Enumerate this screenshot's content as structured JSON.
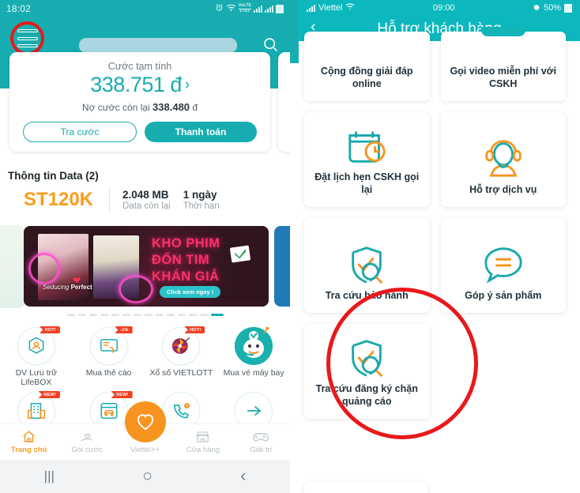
{
  "left_phone": {
    "status_bar": {
      "time": "18:02",
      "icons": [
        "alarm-icon",
        "wifi-icon",
        "volte-icon",
        "signal-icon",
        "signal-icon",
        "battery-icon"
      ],
      "volte_label": "VoLTE"
    },
    "nav": {
      "menu_icon": "hamburger-menu-icon",
      "menu_highlighted": true,
      "highlight_color": "#e8191b",
      "redacted_title": "",
      "search_icon": "search-icon"
    },
    "bill_card": {
      "subtitle": "Cước tạm tính",
      "amount": "338.751 đ",
      "chevron": "›",
      "debt_label": "Nợ cước còn lại",
      "debt_value": "338.480",
      "debt_unit": "đ",
      "button_secondary": "Tra cước",
      "button_primary": "Thanh toán"
    },
    "data_section": {
      "heading": "Thông tin Data (2)",
      "package": "ST120K",
      "items": [
        {
          "value": "2.048 MB",
          "label": "Data còn lại"
        },
        {
          "value": "1 ngày",
          "label": "Thời hạn"
        }
      ]
    },
    "banner": {
      "line1": "KHO PHIM",
      "line2": "ĐỐN TIM",
      "line3": "KHÁN GIẢ",
      "cta": "Click xem ngay !",
      "poster_caption_italic": "Seducing ",
      "poster_caption_bold": "Perfect",
      "logo": "viettel-check-logo",
      "dots_total": 14,
      "active_dot_index": 13
    },
    "services_row1": [
      {
        "label": "DV Lưu trữ LifeBOX",
        "badge": "HOT!",
        "icon": "cloud-storage-icon"
      },
      {
        "label": "Mua thẻ cào",
        "badge": "-2%",
        "icon": "scratch-card-icon"
      },
      {
        "label": "Xổ số VIETLOTT",
        "badge": "HOT!",
        "icon": "lottery-wheel-icon"
      },
      {
        "label": "Mua vé máy bay",
        "badge": "",
        "icon": "mascot-icon"
      }
    ],
    "services_row2": [
      {
        "label": "",
        "badge": "NEW!",
        "icon": "building-icon"
      },
      {
        "label": "",
        "badge": "NEW!",
        "icon": "car-booking-icon"
      },
      {
        "label": "",
        "badge": "",
        "icon": "phone-alert-icon"
      },
      {
        "label": "",
        "badge": "",
        "icon": "arrow-right-icon"
      }
    ],
    "tab_bar": {
      "items": [
        {
          "label": "Trang chủ",
          "icon": "home-icon",
          "active": true
        },
        {
          "label": "Gói cước",
          "icon": "hand-heart-icon",
          "active": false
        },
        {
          "label": "Viettel++",
          "icon": "heart-icon",
          "active": false
        },
        {
          "label": "Cửa hàng",
          "icon": "store-icon",
          "active": false
        },
        {
          "label": "Giải trí",
          "icon": "gamepad-icon",
          "active": false
        }
      ],
      "fab_icon": "heart-icon",
      "fab_color": "#f79420"
    },
    "system_nav": {
      "recents": "|||",
      "home": "○",
      "back": "‹"
    }
  },
  "right_phone": {
    "status_bar": {
      "carrier": "Viettel",
      "signal_icon": "signal-icon",
      "wifi_icon": "wifi-icon",
      "time": "09:00",
      "alarm_icon": "alarm-icon",
      "battery_text": "50%",
      "battery_icon": "battery-icon"
    },
    "header": {
      "back_icon": "chevron-left-icon",
      "title": "Hỗ trợ khách hàng"
    },
    "cards": [
      {
        "label": "Cộng đồng giải đáp online",
        "icon": "community-icon",
        "partial": true
      },
      {
        "label": "Gọi video miễn phí với CSKH",
        "icon": "video-call-icon",
        "partial": true
      },
      {
        "label": "Đặt lịch hẹn CSKH gọi lại",
        "icon": "calendar-clock-icon",
        "partial": false
      },
      {
        "label": "Hỗ trợ dịch vụ",
        "icon": "headset-support-icon",
        "partial": false
      },
      {
        "label": "Tra cứu bảo hành",
        "icon": "shield-check-search-icon",
        "partial": false
      },
      {
        "label": "Góp ý sản phẩm",
        "icon": "chat-feedback-icon",
        "partial": false
      },
      {
        "label": "Tra cứu đăng ký chặn quảng cáo",
        "icon": "shield-check-search-icon",
        "partial": false,
        "highlighted": true
      }
    ],
    "highlight_color": "#e8191b"
  },
  "theme": {
    "teal": "#17adb0",
    "teal_bright": "#0cb8bd",
    "orange": "#f79420",
    "red_highlight": "#e8191b",
    "text_dark": "#22303a",
    "text_muted": "#9aa4ab"
  }
}
